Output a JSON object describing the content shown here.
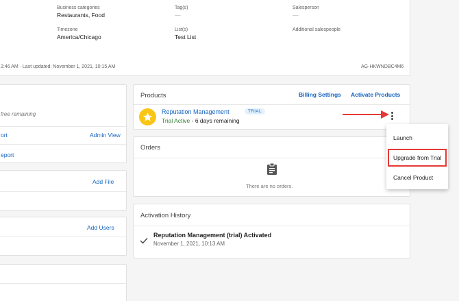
{
  "account": {
    "business_categories": {
      "label": "Business categories",
      "value": "Restaurants, Food"
    },
    "tags": {
      "label": "Tag(s)",
      "value": "—"
    },
    "salesperson": {
      "label": "Salesperson",
      "value": "—"
    },
    "timezone": {
      "label": "Timezone",
      "value": "America/Chicago"
    },
    "lists": {
      "label": "List(s)",
      "value": "Test List"
    },
    "additional_salespeople": {
      "label": "Additional salespeople",
      "value": ""
    },
    "meta_line": "2:46 AM · Last updated: November 1, 2021, 10:15 AM",
    "account_id": "AG-HKWNDBC4M6"
  },
  "left_column": {
    "free_remaining": "free remaining",
    "report_link": "ort",
    "admin_view": "Admin View",
    "report_link_2": "eport",
    "add_file": "Add File",
    "add_users": "Add Users"
  },
  "products": {
    "title": "Products",
    "billing_settings": "Billing Settings",
    "activate_products": "Activate Products",
    "item": {
      "name": "Reputation Management",
      "badge": "TRIAL",
      "status": "Trial Active",
      "remaining": " - 6 days remaining",
      "icon": "star-icon"
    }
  },
  "menu": {
    "items": [
      "Launch",
      "Upgrade from Trial",
      "Cancel Product"
    ]
  },
  "orders": {
    "title": "Orders",
    "empty": "There are no orders."
  },
  "activation_history": {
    "title": "Activation History",
    "entry_title": "Reputation Management (trial) Activated",
    "entry_date": "November 1, 2021, 10:13 AM"
  },
  "colors": {
    "accent": "#1565c0",
    "star": "#f9c516",
    "trial_green": "#2e7d32",
    "annotation_red": "#e53935"
  }
}
